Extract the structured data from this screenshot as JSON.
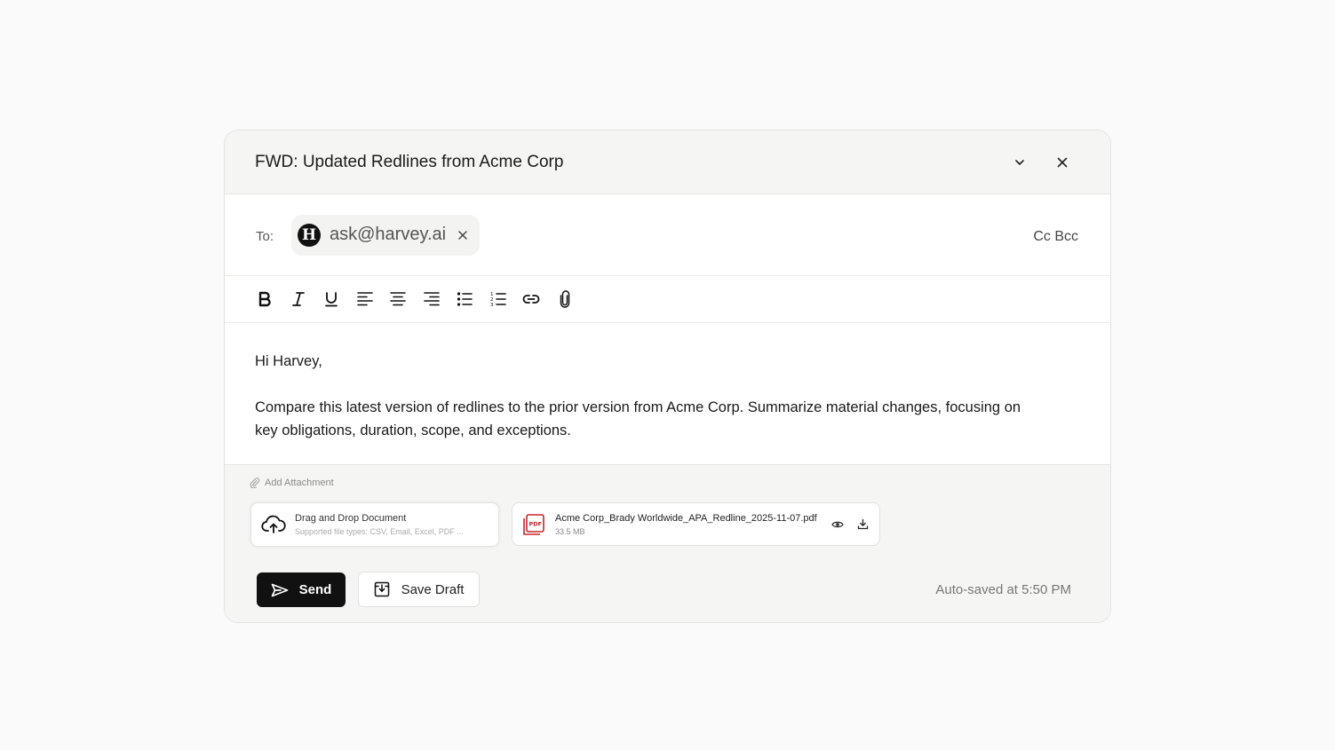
{
  "header": {
    "title": "FWD: Updated Redlines from Acme Corp",
    "collapse_icon": "chevron-down-icon",
    "close_icon": "close-icon"
  },
  "recipients": {
    "to_label": "To:",
    "chips": [
      {
        "avatar_letter": "H",
        "email": "ask@harvey.ai"
      }
    ],
    "cc_label": "Cc",
    "bcc_label": "Bcc"
  },
  "toolbar": {
    "tools": [
      "bold-icon",
      "italic-icon",
      "underline-icon",
      "align-left-icon",
      "align-center-icon",
      "align-right-icon",
      "bullet-list-icon",
      "numbered-list-icon",
      "link-icon",
      "paperclip-icon"
    ]
  },
  "body": {
    "greeting": "Hi Harvey,",
    "paragraph": "Compare this latest version of redlines to the prior version from Acme Corp. Summarize material changes, focusing on key obligations, duration, scope, and exceptions."
  },
  "attachments": {
    "add_label": "Add Attachment",
    "dropzone": {
      "title": "Drag and Drop Document",
      "subtitle": "Supported file types: CSV, Email, Excel, PDF ..."
    },
    "files": [
      {
        "name": "Acme Corp_Brady Worldwide_APA_Redline_2025-11-07.pdf",
        "size": "33.5 MB",
        "icon": "pdf-file-icon"
      }
    ]
  },
  "footer": {
    "send_label": "Send",
    "save_draft_label": "Save Draft",
    "autosave_text": "Auto-saved at 5:50 PM"
  },
  "colors": {
    "primary_button": "#111111",
    "pdf_red": "#c8262b",
    "header_bg": "#f5f5f3"
  }
}
